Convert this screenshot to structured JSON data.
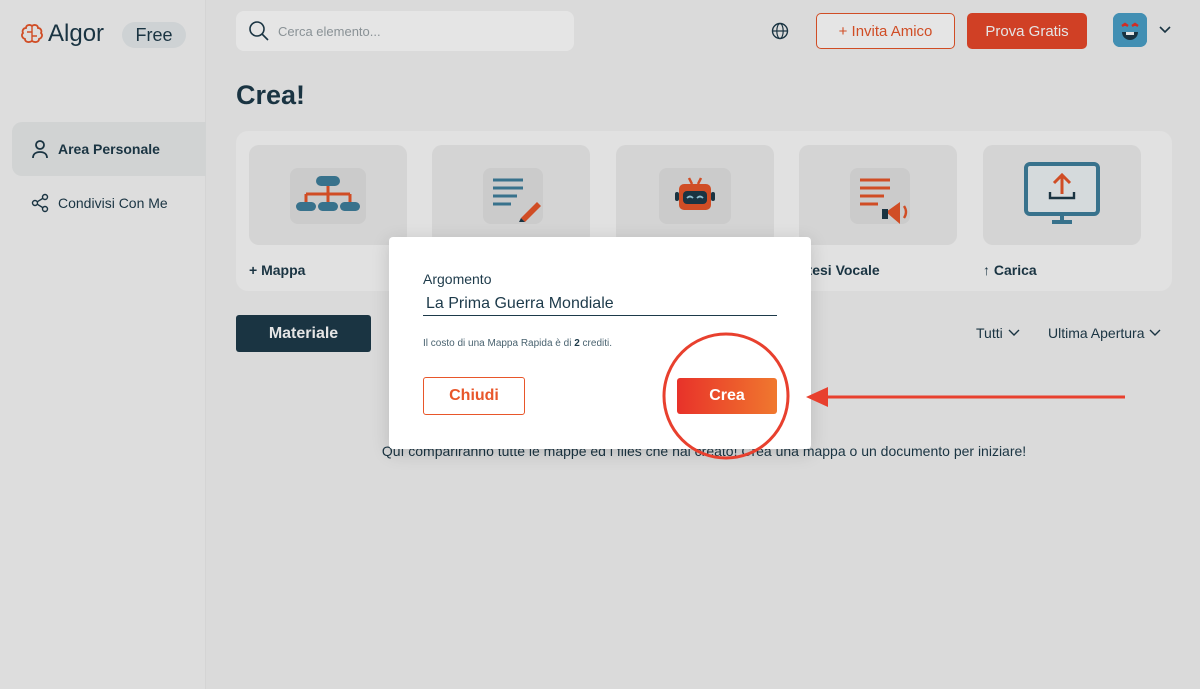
{
  "app": {
    "name": "Algor",
    "plan": "Free"
  },
  "sidebar": {
    "items": [
      {
        "label": "Area Personale",
        "icon": "user-icon"
      },
      {
        "label": "Condivisi Con Me",
        "icon": "share-icon"
      }
    ]
  },
  "header": {
    "search_placeholder": "Cerca elemento...",
    "invite_label": "+ Invita Amico",
    "try_label": "Prova Gratis"
  },
  "main": {
    "title": "Crea!",
    "cards": [
      {
        "label": "+ Mappa",
        "icon": "mind-map-icon"
      },
      {
        "label": "",
        "icon": "document-pen-icon"
      },
      {
        "label": "",
        "icon": "robot-icon"
      },
      {
        "label": "ntesi Vocale",
        "icon": "document-speaker-icon"
      },
      {
        "label": "↑ Carica",
        "icon": "monitor-upload-icon"
      }
    ],
    "materiale_label": "Materiale",
    "filter_all": "Tutti",
    "filter_sort": "Ultima Apertura",
    "empty_message": "Quì compariranno tutte le mappe ed i files che hai creato! Crea una mappa o un documento per iniziare!"
  },
  "modal": {
    "label": "Argomento",
    "value": "La Prima Guerra Mondiale",
    "note_prefix": "Il costo di una Mappa Rapida è di ",
    "note_credits": "2",
    "note_suffix": " crediti.",
    "close_label": "Chiudi",
    "create_label": "Crea"
  },
  "colors": {
    "accent": "#e8562a",
    "dark": "#1d3a4a",
    "annotation": "#e8402e"
  }
}
